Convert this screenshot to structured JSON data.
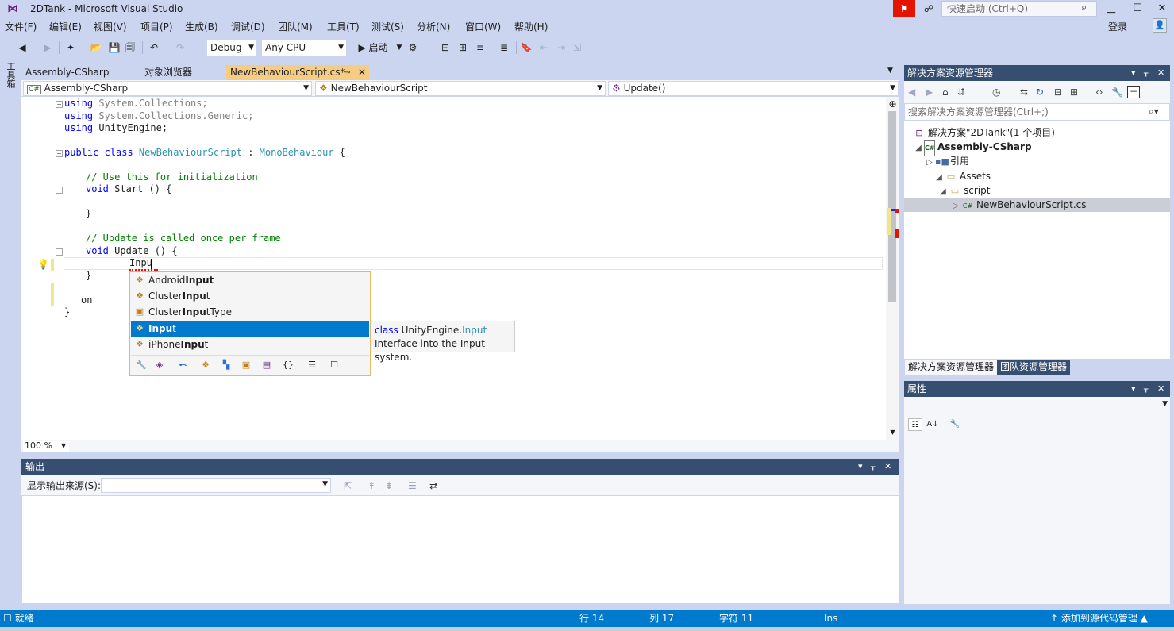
{
  "window": {
    "title": "2DTank - Microsoft Visual Studio",
    "quick_launch_placeholder": "快速启动 (Ctrl+Q)",
    "login": "登录"
  },
  "menu": [
    "文件(F)",
    "编辑(E)",
    "视图(V)",
    "项目(P)",
    "生成(B)",
    "调试(D)",
    "团队(M)",
    "工具(T)",
    "测试(S)",
    "分析(N)",
    "窗口(W)",
    "帮助(H)"
  ],
  "toolbar": {
    "config": "Debug",
    "platform": "Any CPU",
    "start": "▶ 启动"
  },
  "toolbox_label": "工具箱",
  "tabs": [
    {
      "label": "Assembly-CSharp"
    },
    {
      "label": "对象浏览器"
    },
    {
      "label": "NewBehaviourScript.cs*",
      "active": true
    }
  ],
  "nav": {
    "project": "Assembly-CSharp",
    "class": "NewBehaviourScript",
    "member": "Update()"
  },
  "code": {
    "l1_kw": "using",
    "l1_rest": " System.Collections;",
    "l2_kw": "using",
    "l2_rest": " System.Collections.Generic;",
    "l3_kw": "using",
    "l3_rest": " UnityEngine;",
    "l5_kw": "public class ",
    "l5_cls": "NewBehaviourScript",
    "l5_mid": " : ",
    "l5_base": "MonoBehaviour",
    "l5_end": " {",
    "l7": "// Use this for initialization",
    "l8_kw": "void",
    "l8_rest": " Start () {",
    "l10": "}",
    "l12": "// Update is called once per frame",
    "l13_kw": "void",
    "l13_rest": " Update () {",
    "l14": "Inpu",
    "l15": "}",
    "l17": "on",
    "l18": "}"
  },
  "zoom": "100 %",
  "completion": {
    "items": [
      {
        "pre": "Android",
        "match": "Input",
        "post": "",
        "icon": "class-icon"
      },
      {
        "pre": "Cluster",
        "match": "Inpu",
        "post": "t",
        "icon": "class-icon"
      },
      {
        "pre": "Cluster",
        "match": "Inpu",
        "post": "tType",
        "icon": "enum-icon"
      },
      {
        "pre": "",
        "match": "Inpu",
        "post": "t",
        "icon": "class-icon",
        "selected": true
      },
      {
        "pre": "iPhone",
        "match": "Inpu",
        "post": "t",
        "icon": "class-icon"
      }
    ],
    "tooltip_kw": "class",
    "tooltip_ns": " UnityEngine.",
    "tooltip_type": "Input",
    "tooltip_desc": "Interface into the Input system."
  },
  "output": {
    "title": "输出",
    "source_label": "显示输出来源(S):"
  },
  "solution_explorer": {
    "title": "解决方案资源管理器",
    "search_placeholder": "搜索解决方案资源管理器(Ctrl+;)",
    "tree": [
      {
        "label": "解决方案\"2DTank\"(1 个项目)",
        "icon": "solution-icon"
      },
      {
        "label": "Assembly-CSharp",
        "icon": "csproj-icon",
        "bold": true
      },
      {
        "label": "引用",
        "icon": "references-icon"
      },
      {
        "label": "Assets",
        "icon": "folder-icon"
      },
      {
        "label": "script",
        "icon": "folder-icon"
      },
      {
        "label": "NewBehaviourScript.cs",
        "icon": "csfile-icon",
        "selected": true
      }
    ],
    "tab1": "解决方案资源管理器",
    "tab2": "团队资源管理器"
  },
  "properties": {
    "title": "属性"
  },
  "status": {
    "ready": "就绪",
    "line": "行 14",
    "col": "列 17",
    "char": "字符 11",
    "mode": "Ins",
    "source_control": "↑ 添加到源代码管理 ▲"
  },
  "colors": {
    "chrome": "#ccd5f0",
    "accent": "#007acc",
    "panel_header": "#364e6f",
    "active_tab": "#f5cc84"
  }
}
